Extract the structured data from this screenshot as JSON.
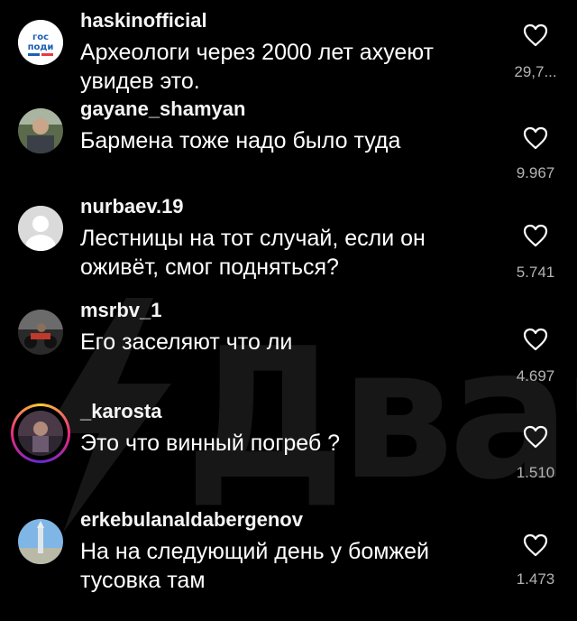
{
  "watermark": {
    "text": "Двач",
    "brand": "2ch lightning logo"
  },
  "colors": {
    "background": "#000000",
    "text": "#ffffff",
    "secondary_text": "#b3b3b3"
  },
  "comments": [
    {
      "username": "haskinofficial",
      "text": "Археологи через 2000 лет ахуеют увидев это.",
      "likes": "29,7...",
      "avatar": "gosuslugi-logo",
      "avatar_text": "гос\nподи"
    },
    {
      "username": "gayane_shamyan",
      "text": "Бармена тоже надо было туда",
      "likes": "9.967",
      "avatar": "user-photo"
    },
    {
      "username": "nurbaev.19",
      "text": "Лестницы на тот случай, если он оживёт, смог подняться?",
      "likes": "5.741",
      "avatar": "default-avatar"
    },
    {
      "username": "msrbv_1",
      "text": "Его заселяют что ли",
      "likes": "4.697",
      "avatar": "motorcycle-photo"
    },
    {
      "username": "_karosta",
      "text": "Это что винный погреб ?",
      "likes": "1.510",
      "avatar": "story-ring-photo"
    },
    {
      "username": "erkebulanaldabergenov",
      "text": "На на следующий день у бомжей тусовка там",
      "likes": "1.473",
      "avatar": "landscape-photo"
    }
  ]
}
